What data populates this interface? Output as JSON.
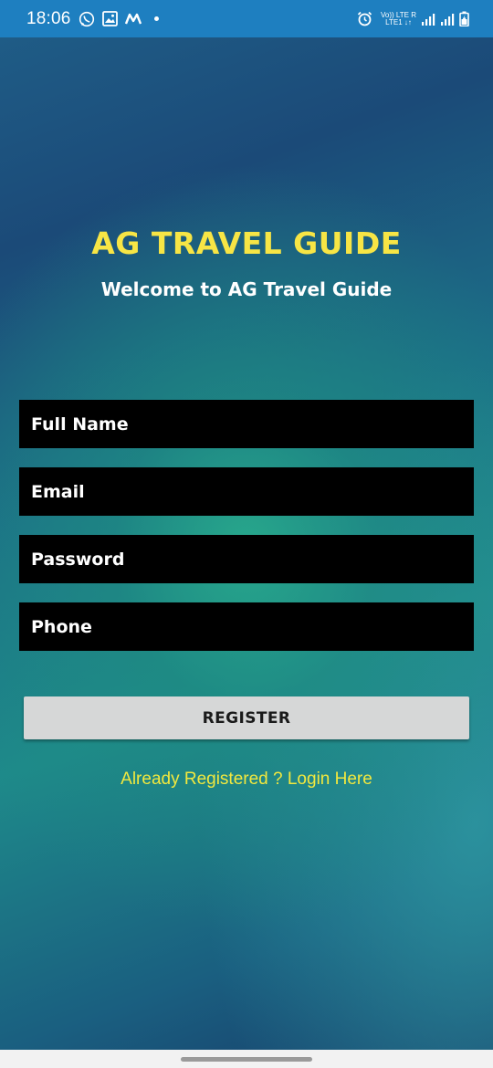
{
  "status_bar": {
    "time": "18:06",
    "net_top": "Vo)) LTE R",
    "net_bottom": "LTE1 ↓↑",
    "icons": [
      "whatsapp-icon",
      "gallery-icon",
      "m-app-icon",
      "notification-dot-icon",
      "alarm-icon",
      "signal-1-icon",
      "signal-2-icon",
      "battery-charging-icon"
    ]
  },
  "header": {
    "title": "AG TRAVEL GUIDE",
    "subtitle": "Welcome to AG Travel Guide"
  },
  "form": {
    "full_name_placeholder": "Full Name",
    "email_placeholder": "Email",
    "password_placeholder": "Password",
    "phone_placeholder": "Phone"
  },
  "actions": {
    "register_label": "REGISTER",
    "login_link": "Already Registered ? Login Here"
  },
  "colors": {
    "title": "#f7e545",
    "link": "#f2e83e",
    "status_bar": "#1e7fc0",
    "field_bg": "#000000",
    "button_bg": "#d6d7d7"
  }
}
